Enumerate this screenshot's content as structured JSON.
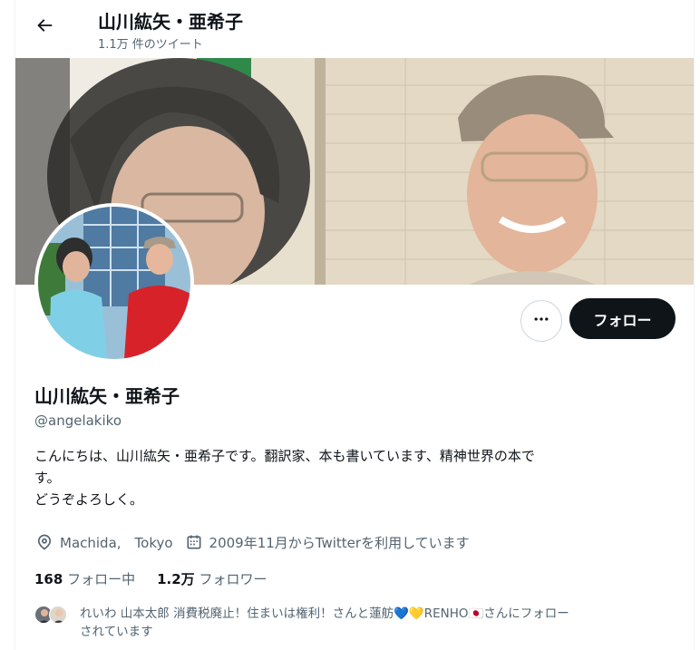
{
  "header": {
    "back_icon": "arrow-left-icon",
    "title": "山川紘矢・亜希子",
    "subtitle": "1.1万 件のツイート"
  },
  "profile": {
    "name": "山川紘矢・亜希子",
    "handle": "@angelakiko",
    "bio": [
      "こんにちは、山川紘矢・亜希子です。翻訳家、本も書いています、精神世界の本で",
      "す。",
      "どうぞよろしく。"
    ],
    "location": "Machida,　Tokyo",
    "location_icon": "location-pin-icon",
    "joined": "2009年11月からTwitterを利用しています",
    "joined_icon": "calendar-icon",
    "following_count": "168",
    "following_label": "フォロー中",
    "followers_count": "1.2万",
    "followers_label": "フォロワー"
  },
  "actions": {
    "more_icon": "more-horizontal-icon",
    "follow_label": "フォロー"
  },
  "followed_by": {
    "line1": "れいわ 山本太郎 消費税廃止！住まいは権利！さんと蓮舫💙💛RENHO🇯🇵さんにフォロー",
    "line2": "されています"
  },
  "colors": {
    "text_primary": "#0f1419",
    "text_secondary": "#536471",
    "follow_button": "#0f1419",
    "border": "#cfd9de"
  }
}
